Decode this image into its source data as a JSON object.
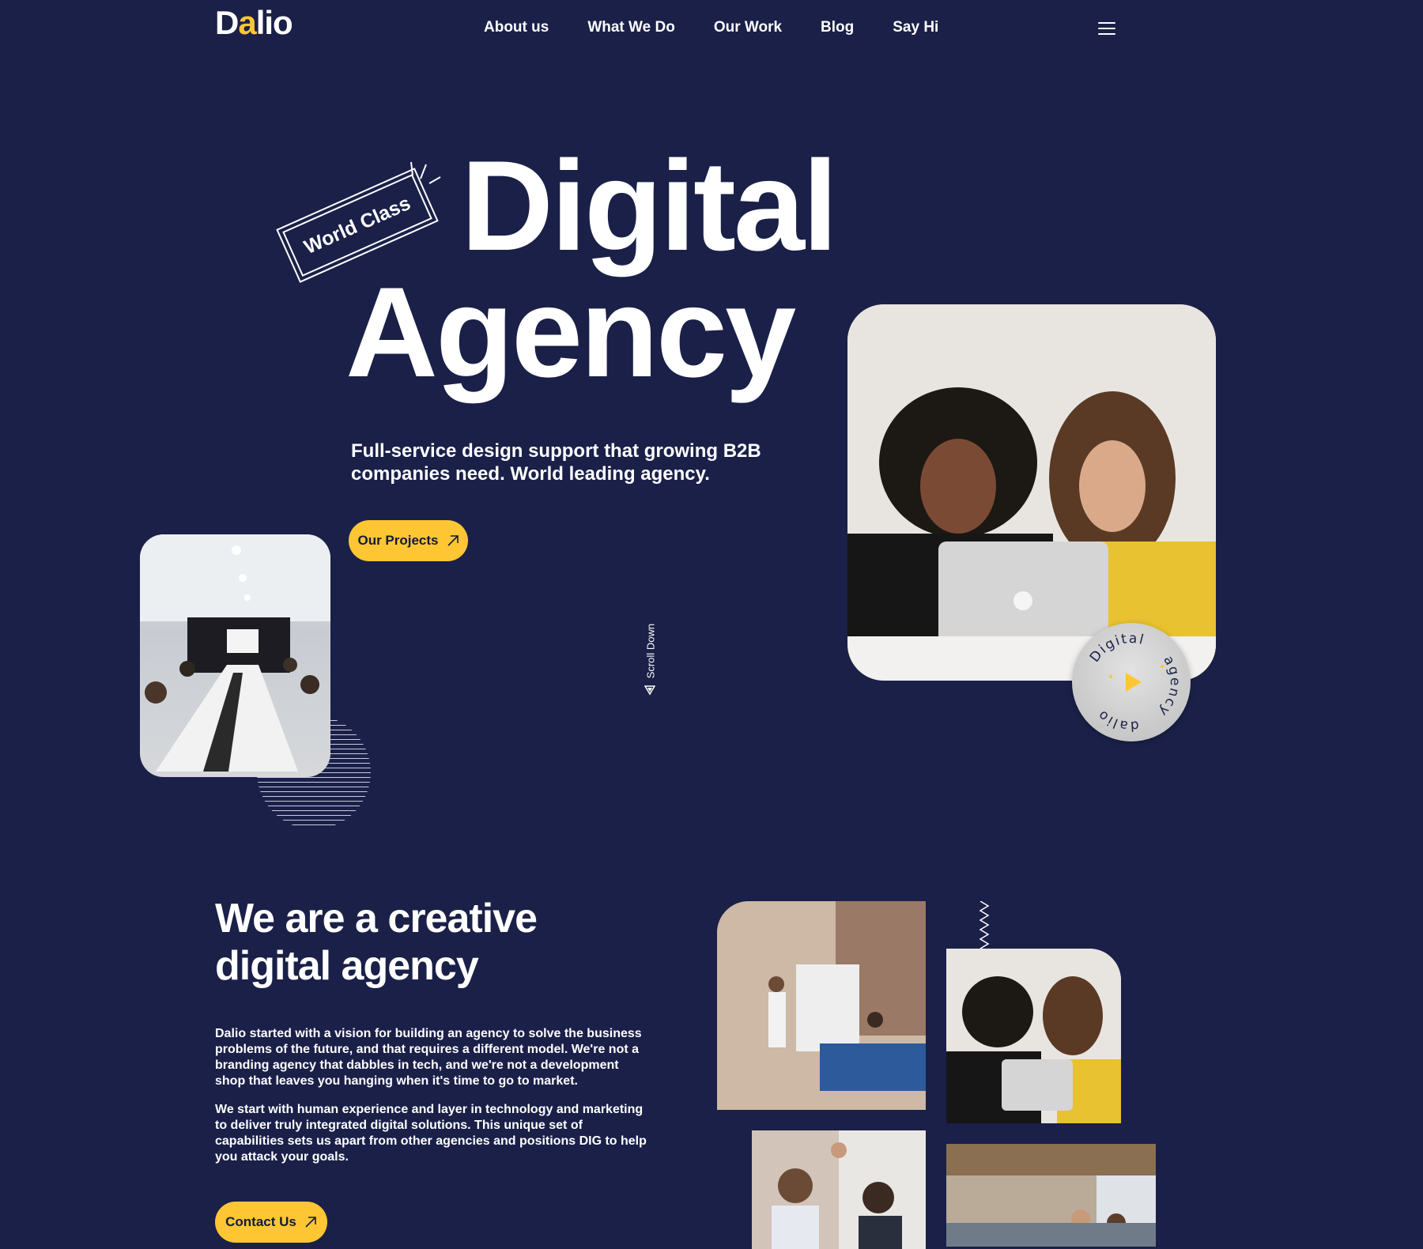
{
  "header": {
    "logo": {
      "prefix": "D",
      "accent": "a",
      "suffix": "lio"
    },
    "nav": [
      "About us",
      "What We Do",
      "Our Work",
      "Blog",
      "Say Hi"
    ],
    "menu_icon": "hamburger-icon"
  },
  "hero": {
    "badge": "World Class",
    "title_line1": "Digital",
    "title_line2": "Agency",
    "subtitle": "Full-service design support that growing B2B companies need. World leading agency.",
    "cta_label": "Our Projects",
    "scroll_label": "Scroll Down",
    "circle_badge": {
      "top": "Digital",
      "right": "agency",
      "bottom": "dalio"
    }
  },
  "about": {
    "title": "We are a creative digital agency",
    "p1": "Dalio started with a vision for building an agency to solve the business problems of the future, and that requires a different model. We're not a branding agency that dabbles in tech, and we're not a development shop that leaves you hanging when it's time to go to market.",
    "p2": "We start with human experience and layer in technology and marketing to deliver truly integrated digital solutions. This unique set of capabilities sets us apart from other agencies and positions DIG to help you attack your goals.",
    "cta_label": "Contact Us"
  },
  "colors": {
    "background": "#1a2048",
    "accent": "#ffc634",
    "text": "#ffffff",
    "button_text": "#141a3a"
  },
  "icons": {
    "arrow": "arrow-up-right-icon",
    "play": "play-icon",
    "scroll": "triangle-down-icon"
  }
}
